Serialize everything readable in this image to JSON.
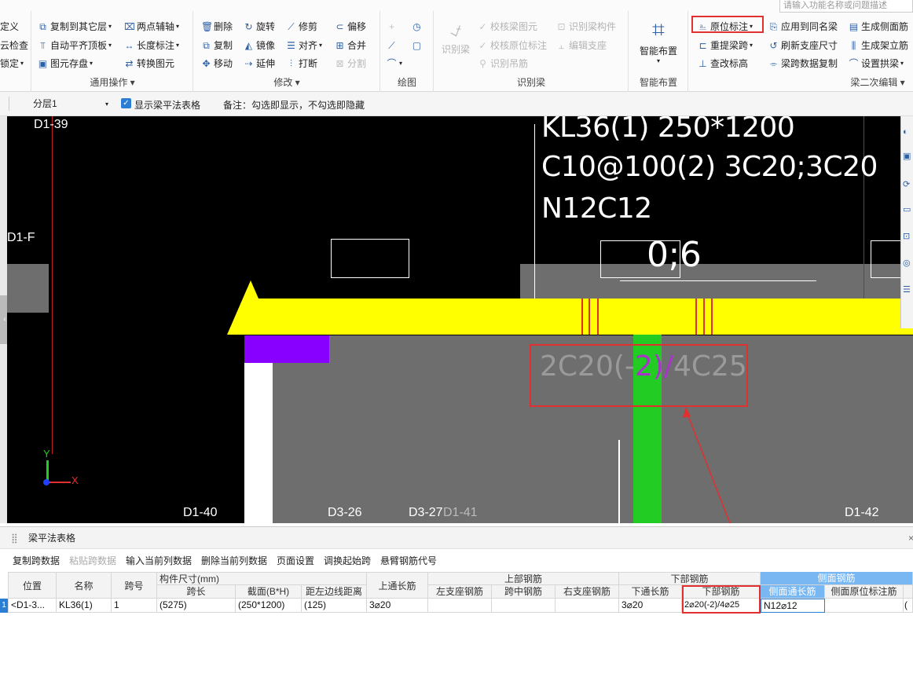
{
  "search": {
    "placeholder": "请输入功能名称或问题描述"
  },
  "ribbon": {
    "g1": {
      "r1": "定义",
      "r2": "云检查",
      "r3": "锁定"
    },
    "g2": {
      "c1": [
        "复制到其它层",
        "自动平齐顶板",
        "图元存盘"
      ],
      "c2": [
        "两点辅轴",
        "长度标注",
        "转换图元"
      ],
      "name": "通用操作"
    },
    "g3": {
      "c1": [
        "删除",
        "复制",
        "移动"
      ],
      "c2": [
        "旋转",
        "镜像",
        "延伸"
      ],
      "c3": [
        "修剪",
        "对齐",
        "打断"
      ],
      "c4": [
        "偏移",
        "合并",
        "分割"
      ],
      "name": "修改"
    },
    "g4": {
      "name": "绘图"
    },
    "g5": {
      "big": "识别梁",
      "c1": [
        "校核梁图元",
        "校核原位标注",
        "识别吊筋"
      ],
      "c2": [
        "识别梁构件",
        "编辑支座"
      ],
      "name": "识别梁"
    },
    "g6": {
      "big": "智能布置",
      "name": "智能布置"
    },
    "g7": {
      "c1": [
        "原位标注",
        "重提梁跨",
        "查改标高"
      ],
      "c2": [
        "应用到同名梁",
        "刷新支座尺寸",
        "梁跨数据复制"
      ],
      "c3": [
        "生成侧面筋",
        "生成架立筋",
        "设置拱梁"
      ],
      "name": "梁二次编辑"
    }
  },
  "bar2": {
    "layer": "分层1",
    "checkbox_label": "显示梁平法表格",
    "note": "备注：勾选即显示，不勾选即隐藏"
  },
  "canvas": {
    "axis_labels": [
      "D1-39",
      "D1-F",
      "D1-40",
      "D3-26",
      "D3-27",
      "D1-41",
      "D1-42"
    ],
    "beam_text": [
      "KL36(1) 250*1200",
      "C10@100(2) 3C20;3C20",
      "N12C12"
    ],
    "dim_text": "0;6",
    "bottom_rebar": {
      "a": "2C20(-",
      "b": "2)/",
      "c": "4C25"
    },
    "ucs": {
      "x": "X",
      "y": "Y"
    }
  },
  "panel": {
    "title": "梁平法表格",
    "toolbar": [
      "复制跨数据",
      "粘贴跨数据",
      "输入当前列数据",
      "删除当前列数据",
      "页面设置",
      "调换起始跨",
      "悬臂钢筋代号"
    ],
    "headers": {
      "position": "位置",
      "name": "名称",
      "span_no": "跨号",
      "component_size": "构件尺寸(mm)",
      "span_len": "跨长",
      "section": "截面(B*H)",
      "edge_dist": "距左边线距离",
      "top_through": "上通长筋",
      "top_rebar": "上部钢筋",
      "left_seat": "左支座钢筋",
      "mid": "跨中钢筋",
      "right_seat": "右支座钢筋",
      "bottom_rebar": "下部钢筋",
      "bottom_through": "下通长筋",
      "bottom": "下部钢筋",
      "side_rebar": "侧面钢筋",
      "side_through": "侧面通长筋",
      "side_in_situ": "侧面原位标注筋"
    },
    "row": {
      "idx": "1",
      "position": "<D1-3...",
      "name": "KL36(1)",
      "span_no": "1",
      "span_len": "(5275)",
      "section": "(250*1200)",
      "edge_dist": "(125)",
      "top_through": "3⌀20",
      "left_seat": "",
      "mid": "",
      "right_seat": "",
      "bottom_through": "3⌀20",
      "bottom": "2⌀20(-2)/4⌀25",
      "side_through": "N12⌀12",
      "side_in_situ": "",
      "extra": "("
    }
  },
  "colors": {
    "highlight": "#e03030",
    "beam": "#ffff00",
    "column": "#22cc22",
    "slab": "#6e6e6e",
    "purple": "#8800ff"
  }
}
